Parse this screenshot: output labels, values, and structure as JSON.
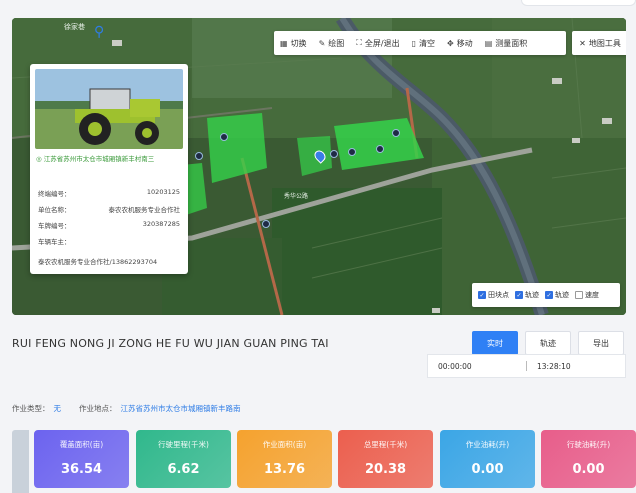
{
  "toolbar": {
    "items": [
      {
        "icon": "grid-icon",
        "label": "切换"
      },
      {
        "icon": "pencil-icon",
        "label": "绘图"
      },
      {
        "icon": "fullscreen-icon",
        "label": "全屏/退出"
      },
      {
        "icon": "trash-icon",
        "label": "清空"
      },
      {
        "icon": "move-icon",
        "label": "移动"
      },
      {
        "icon": "measure-icon",
        "label": "测量面积"
      }
    ],
    "map_tools": {
      "icon": "close-icon",
      "label": "地图工具"
    }
  },
  "map": {
    "top_place_label": "徐家巷",
    "road_label": "秀华公路",
    "legend": [
      {
        "label": "田块点",
        "checked": true
      },
      {
        "label": "轨迹",
        "checked": true
      },
      {
        "label": "轨迹",
        "checked": true
      },
      {
        "label": "速度",
        "checked": false
      }
    ]
  },
  "info_card": {
    "address": "江苏省苏州市太仓市城厢镇新丰村南三",
    "rows": [
      {
        "label": "终端编号：",
        "value": "10203125"
      },
      {
        "label": "单位名称：",
        "value": "泰农农机服务专业合作社"
      },
      {
        "label": "车牌编号：",
        "value": "320387285"
      },
      {
        "label": "车辆车主：",
        "value": ""
      }
    ],
    "owner_line": "泰农农机服务专业合作社/13862293704"
  },
  "page": {
    "title": "RUI FENG NONG JI ZONG HE FU WU JIAN GUAN PING TAI",
    "buttons": {
      "realtime": "实时",
      "history": "轨迹",
      "export": "导出"
    },
    "time_start": "00:00:00",
    "time_end": "13:28:10",
    "work_type_label": "作业类型：",
    "work_type_value": "无",
    "work_place_label": "作业地点：",
    "work_place_value": "江苏省苏州市太仓市城厢镇新丰路南"
  },
  "stats": [
    {
      "label": "覆盖面积(亩)",
      "value": "36.54",
      "color": "#6c63ef"
    },
    {
      "label": "行驶里程(千米)",
      "value": "6.62",
      "color": "#30b88c"
    },
    {
      "label": "作业面积(亩)",
      "value": "13.76",
      "color": "#f5a22e"
    },
    {
      "label": "总里程(千米)",
      "value": "20.38",
      "color": "#ec5f4e"
    },
    {
      "label": "作业油耗(升)",
      "value": "0.00",
      "color": "#3ba6e6"
    },
    {
      "label": "行驶油耗(升)",
      "value": "0.00",
      "color": "#e85d8a"
    }
  ]
}
